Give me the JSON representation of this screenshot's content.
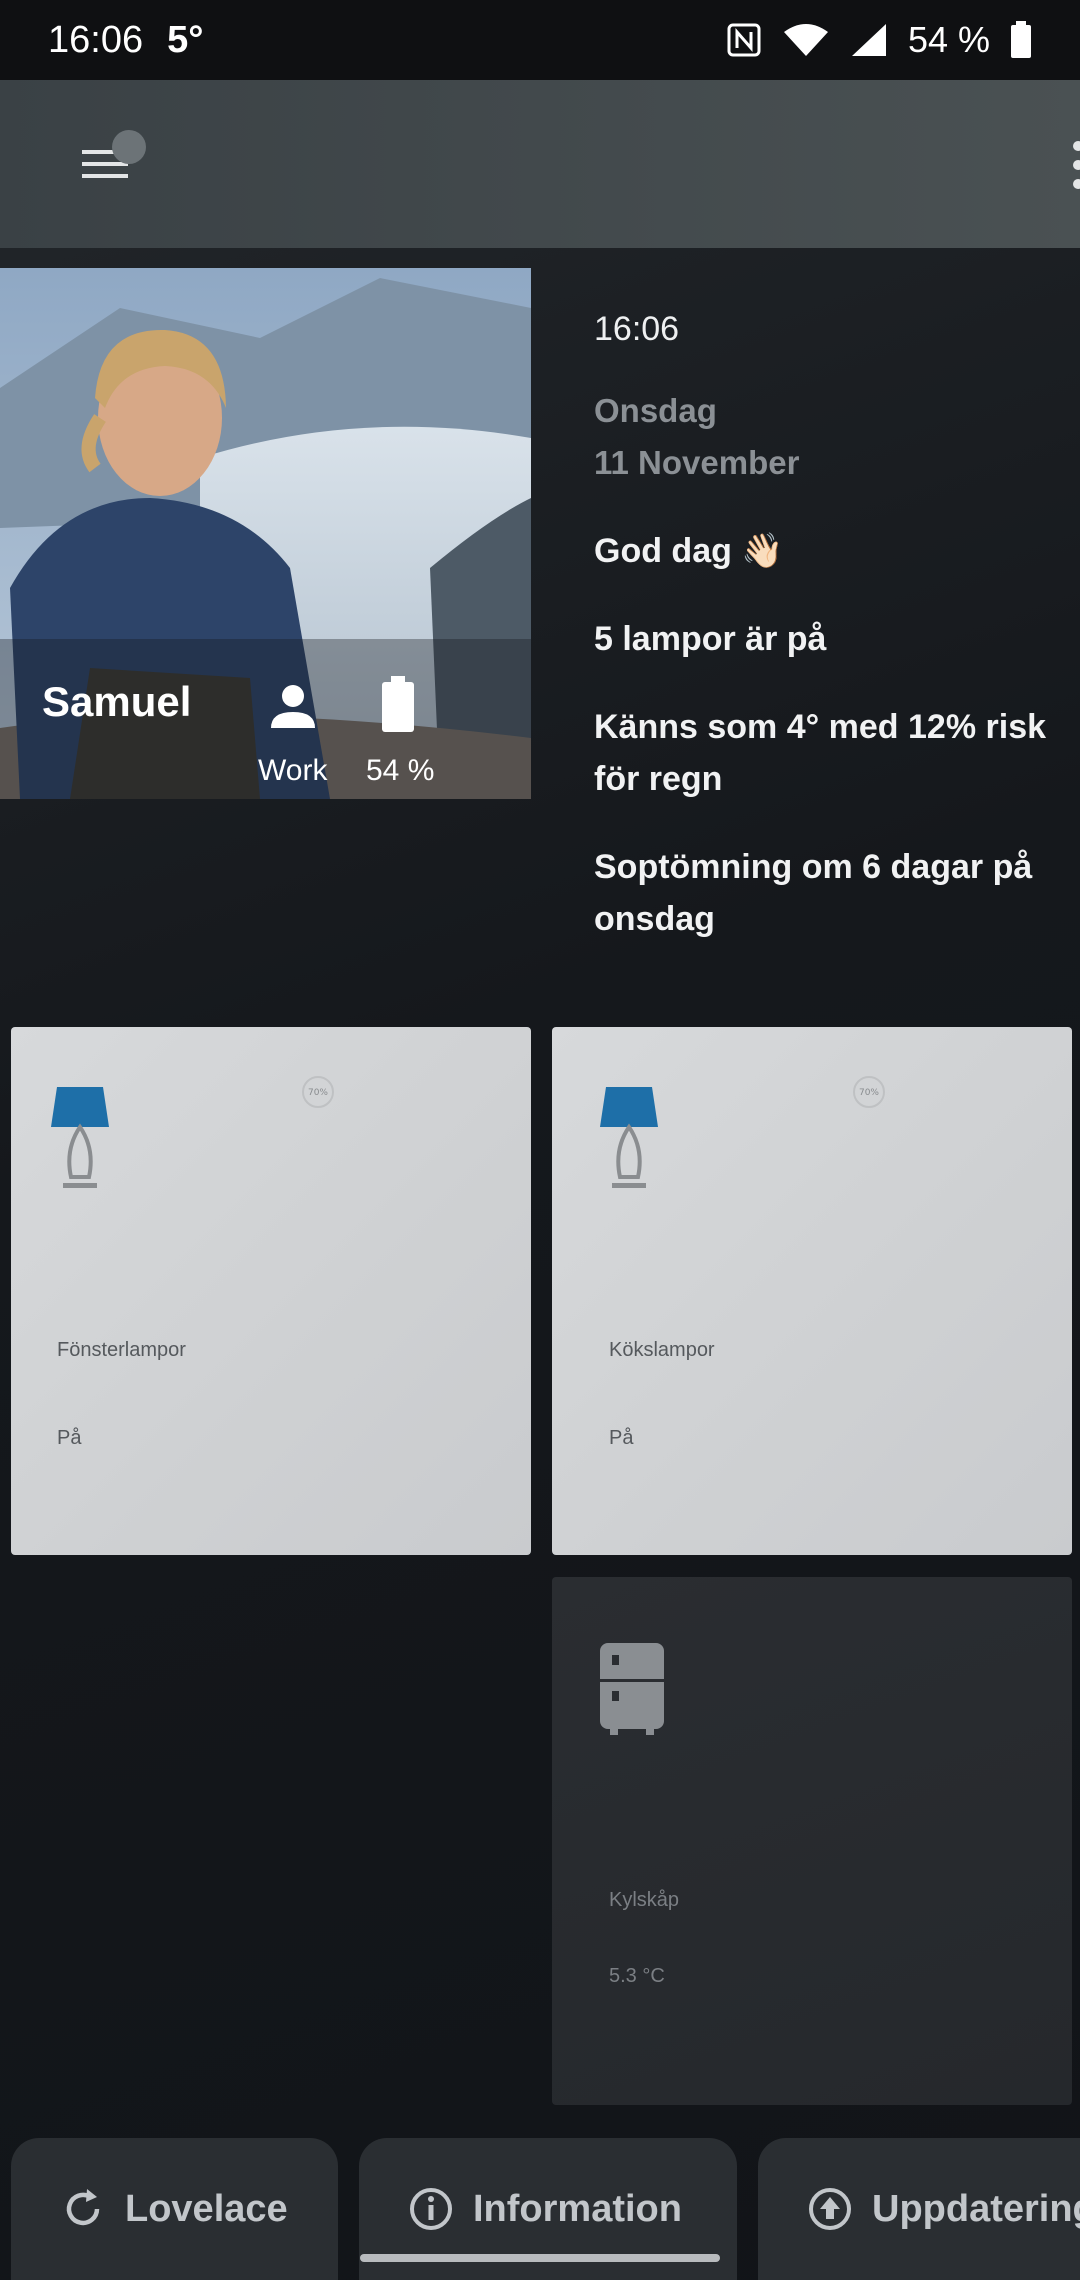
{
  "status_bar": {
    "time": "16:06",
    "temperature": "5°",
    "battery_pct": "54 %"
  },
  "toolbar": {
    "menu_icon": "hamburger-menu-icon",
    "more_icon": "more-vertical-icon"
  },
  "person": {
    "name": "Samuel",
    "state": "Work",
    "battery": "54 %"
  },
  "info": {
    "time": "16:06",
    "weekday": "Onsdag",
    "date": "11 November",
    "greeting": "God dag 👋🏻",
    "lamps": "5 lampor är på",
    "weather": "Känns som 4° med 12% risk för regn",
    "garbage": "Soptömning om 6 dagar på onsdag"
  },
  "tiles": [
    {
      "name": "Fönsterlampor",
      "state": "På",
      "icon": "table-lamp-icon",
      "brightness": "70%"
    },
    {
      "name": "Kökslampor",
      "state": "På",
      "icon": "table-lamp-icon",
      "brightness": "70%"
    },
    {
      "name": "Kylskåp",
      "state": "5.3 °C",
      "icon": "fridge-icon"
    }
  ],
  "bottom_buttons": [
    {
      "label": "Lovelace",
      "icon": "refresh-icon"
    },
    {
      "label": "Information",
      "icon": "info-icon"
    },
    {
      "label": "Uppdateringar",
      "icon": "upload-icon"
    }
  ],
  "colors": {
    "lamp_shade": "#1e6fa8",
    "tile_light": "#d5d7d9",
    "tile_dark": "#282b2f",
    "toolbar": "#434a4d"
  }
}
